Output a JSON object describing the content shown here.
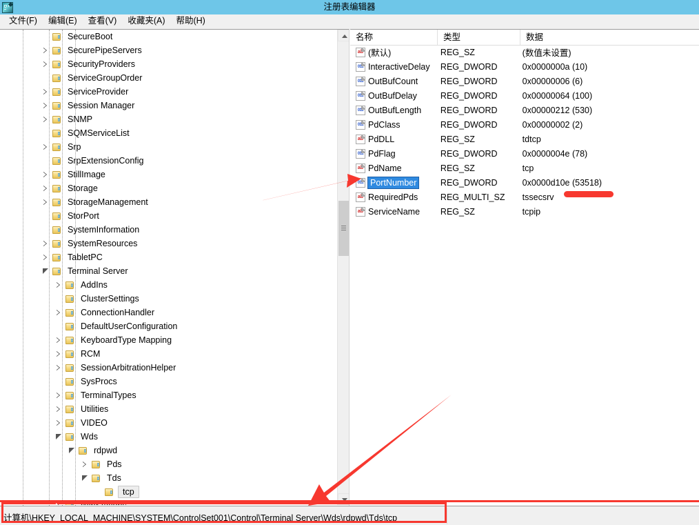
{
  "window": {
    "title": "注册表编辑器",
    "icon": "registry-editor-icon",
    "titlebar_color": "#6ec6e8"
  },
  "menubar": {
    "items": [
      {
        "label": "文件(F)",
        "name": "menu-file"
      },
      {
        "label": "编辑(E)",
        "name": "menu-edit"
      },
      {
        "label": "查看(V)",
        "name": "menu-view"
      },
      {
        "label": "收藏夹(A)",
        "name": "menu-favorites"
      },
      {
        "label": "帮助(H)",
        "name": "menu-help"
      }
    ]
  },
  "tree": {
    "nodes": [
      {
        "label": "SecureBoot",
        "indent": 4,
        "state": "leaf",
        "selected": false
      },
      {
        "label": "SecurePipeServers",
        "indent": 4,
        "state": "collapsed",
        "selected": false
      },
      {
        "label": "SecurityProviders",
        "indent": 4,
        "state": "collapsed",
        "selected": false
      },
      {
        "label": "ServiceGroupOrder",
        "indent": 4,
        "state": "leaf",
        "selected": false
      },
      {
        "label": "ServiceProvider",
        "indent": 4,
        "state": "collapsed",
        "selected": false
      },
      {
        "label": "Session Manager",
        "indent": 4,
        "state": "collapsed",
        "selected": false
      },
      {
        "label": "SNMP",
        "indent": 4,
        "state": "collapsed",
        "selected": false
      },
      {
        "label": "SQMServiceList",
        "indent": 4,
        "state": "leaf",
        "selected": false
      },
      {
        "label": "Srp",
        "indent": 4,
        "state": "collapsed",
        "selected": false
      },
      {
        "label": "SrpExtensionConfig",
        "indent": 4,
        "state": "leaf",
        "selected": false
      },
      {
        "label": "StillImage",
        "indent": 4,
        "state": "collapsed",
        "selected": false
      },
      {
        "label": "Storage",
        "indent": 4,
        "state": "collapsed",
        "selected": false
      },
      {
        "label": "StorageManagement",
        "indent": 4,
        "state": "collapsed",
        "selected": false
      },
      {
        "label": "StorPort",
        "indent": 4,
        "state": "leaf",
        "selected": false
      },
      {
        "label": "SystemInformation",
        "indent": 4,
        "state": "leaf",
        "selected": false
      },
      {
        "label": "SystemResources",
        "indent": 4,
        "state": "collapsed",
        "selected": false
      },
      {
        "label": "TabletPC",
        "indent": 4,
        "state": "collapsed",
        "selected": false
      },
      {
        "label": "Terminal Server",
        "indent": 4,
        "state": "expanded",
        "selected": false
      },
      {
        "label": "AddIns",
        "indent": 5,
        "state": "collapsed",
        "selected": false
      },
      {
        "label": "ClusterSettings",
        "indent": 5,
        "state": "leaf",
        "selected": false
      },
      {
        "label": "ConnectionHandler",
        "indent": 5,
        "state": "collapsed",
        "selected": false
      },
      {
        "label": "DefaultUserConfiguration",
        "indent": 5,
        "state": "leaf",
        "selected": false
      },
      {
        "label": "KeyboardType Mapping",
        "indent": 5,
        "state": "collapsed",
        "selected": false
      },
      {
        "label": "RCM",
        "indent": 5,
        "state": "collapsed",
        "selected": false
      },
      {
        "label": "SessionArbitrationHelper",
        "indent": 5,
        "state": "collapsed",
        "selected": false
      },
      {
        "label": "SysProcs",
        "indent": 5,
        "state": "leaf",
        "selected": false
      },
      {
        "label": "TerminalTypes",
        "indent": 5,
        "state": "collapsed",
        "selected": false
      },
      {
        "label": "Utilities",
        "indent": 5,
        "state": "collapsed",
        "selected": false
      },
      {
        "label": "VIDEO",
        "indent": 5,
        "state": "collapsed",
        "selected": false
      },
      {
        "label": "Wds",
        "indent": 5,
        "state": "expanded",
        "selected": false
      },
      {
        "label": "rdpwd",
        "indent": 6,
        "state": "expanded",
        "selected": false
      },
      {
        "label": "Pds",
        "indent": 7,
        "state": "collapsed",
        "selected": false
      },
      {
        "label": "Tds",
        "indent": 7,
        "state": "expanded",
        "selected": false
      },
      {
        "label": "tcp",
        "indent": 8,
        "state": "leaf",
        "selected": true
      },
      {
        "label": "WinStations",
        "indent": 5,
        "state": "collapsed",
        "selected": false
      }
    ]
  },
  "values": {
    "columns": [
      {
        "label": "名称",
        "name": "column-name"
      },
      {
        "label": "类型",
        "name": "column-type"
      },
      {
        "label": "数据",
        "name": "column-data"
      }
    ],
    "rows": [
      {
        "name": "(默认)",
        "type": "REG_SZ",
        "data": "(数值未设置)",
        "icon": "string-value-icon",
        "selected": false
      },
      {
        "name": "InteractiveDelay",
        "type": "REG_DWORD",
        "data": "0x0000000a (10)",
        "icon": "dword-value-icon",
        "selected": false
      },
      {
        "name": "OutBufCount",
        "type": "REG_DWORD",
        "data": "0x00000006 (6)",
        "icon": "dword-value-icon",
        "selected": false
      },
      {
        "name": "OutBufDelay",
        "type": "REG_DWORD",
        "data": "0x00000064 (100)",
        "icon": "dword-value-icon",
        "selected": false
      },
      {
        "name": "OutBufLength",
        "type": "REG_DWORD",
        "data": "0x00000212 (530)",
        "icon": "dword-value-icon",
        "selected": false
      },
      {
        "name": "PdClass",
        "type": "REG_DWORD",
        "data": "0x00000002 (2)",
        "icon": "dword-value-icon",
        "selected": false
      },
      {
        "name": "PdDLL",
        "type": "REG_SZ",
        "data": "tdtcp",
        "icon": "string-value-icon",
        "selected": false
      },
      {
        "name": "PdFlag",
        "type": "REG_DWORD",
        "data": "0x0000004e (78)",
        "icon": "dword-value-icon",
        "selected": false
      },
      {
        "name": "PdName",
        "type": "REG_SZ",
        "data": "tcp",
        "icon": "string-value-icon",
        "selected": false
      },
      {
        "name": "PortNumber",
        "type": "REG_DWORD",
        "data": "0x0000d10e (53518)",
        "icon": "dword-value-icon",
        "selected": true
      },
      {
        "name": "RequiredPds",
        "type": "REG_MULTI_SZ",
        "data": "tssecsrv",
        "icon": "string-value-icon",
        "selected": false
      },
      {
        "name": "ServiceName",
        "type": "REG_SZ",
        "data": "tcpip",
        "icon": "string-value-icon",
        "selected": false
      }
    ]
  },
  "statusbar": {
    "path": "计算机\\HKEY_LOCAL_MACHINE\\SYSTEM\\ControlSet001\\Control\\Terminal Server\\Wds\\rdpwd\\Tds\\tcp"
  },
  "annotations": {
    "color": "#f7382f",
    "arrow_to_portnumber": "red-arrow-pointing-to-portnumber",
    "arrow_to_statusbar": "red-arrow-pointing-to-status-path",
    "underline_requiredpds": "red-underline-mark",
    "statusbar_highlight_box": "red-rectangle-around-path"
  }
}
